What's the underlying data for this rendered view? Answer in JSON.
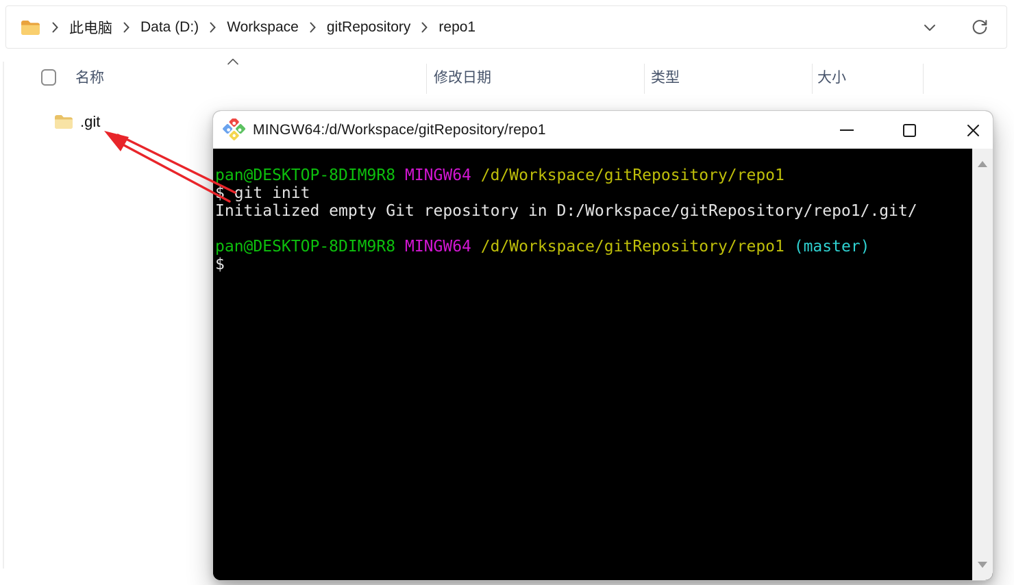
{
  "explorer": {
    "breadcrumb": [
      "此电脑",
      "Data (D:)",
      "Workspace",
      "gitRepository",
      "repo1"
    ],
    "columns": [
      "名称",
      "修改日期",
      "类型",
      "大小"
    ],
    "files": [
      {
        "name": ".git",
        "type": "folder"
      }
    ]
  },
  "terminal": {
    "title": "MINGW64:/d/Workspace/gitRepository/repo1",
    "lines": [
      {
        "segments": [
          {
            "text": "pan@DESKTOP-8DIM9R8",
            "color": "green"
          },
          {
            "text": " ",
            "color": "default"
          },
          {
            "text": "MINGW64",
            "color": "magenta"
          },
          {
            "text": " ",
            "color": "default"
          },
          {
            "text": "/d/Workspace/gitRepository/repo1",
            "color": "yellow"
          }
        ]
      },
      {
        "segments": [
          {
            "text": "$ git init",
            "color": "default"
          }
        ]
      },
      {
        "segments": [
          {
            "text": "Initialized empty Git repository in D:/Workspace/gitRepository/repo1/.git/",
            "color": "default"
          }
        ]
      },
      {
        "segments": []
      },
      {
        "segments": [
          {
            "text": "pan@DESKTOP-8DIM9R8",
            "color": "green"
          },
          {
            "text": " ",
            "color": "default"
          },
          {
            "text": "MINGW64",
            "color": "magenta"
          },
          {
            "text": " ",
            "color": "default"
          },
          {
            "text": "/d/Workspace/gitRepository/repo1",
            "color": "yellow"
          },
          {
            "text": " ",
            "color": "default"
          },
          {
            "text": "(master)",
            "color": "cyan"
          }
        ]
      },
      {
        "segments": [
          {
            "text": "$",
            "color": "default"
          }
        ]
      }
    ],
    "colors": {
      "green": "#0dbf0d",
      "magenta": "#d216d2",
      "yellow": "#bfbf0a",
      "cyan": "#2fd1d1",
      "default": "#e4e4e4",
      "background": "#000000"
    }
  },
  "annotation": {
    "arrow_color": "#e8252a"
  }
}
